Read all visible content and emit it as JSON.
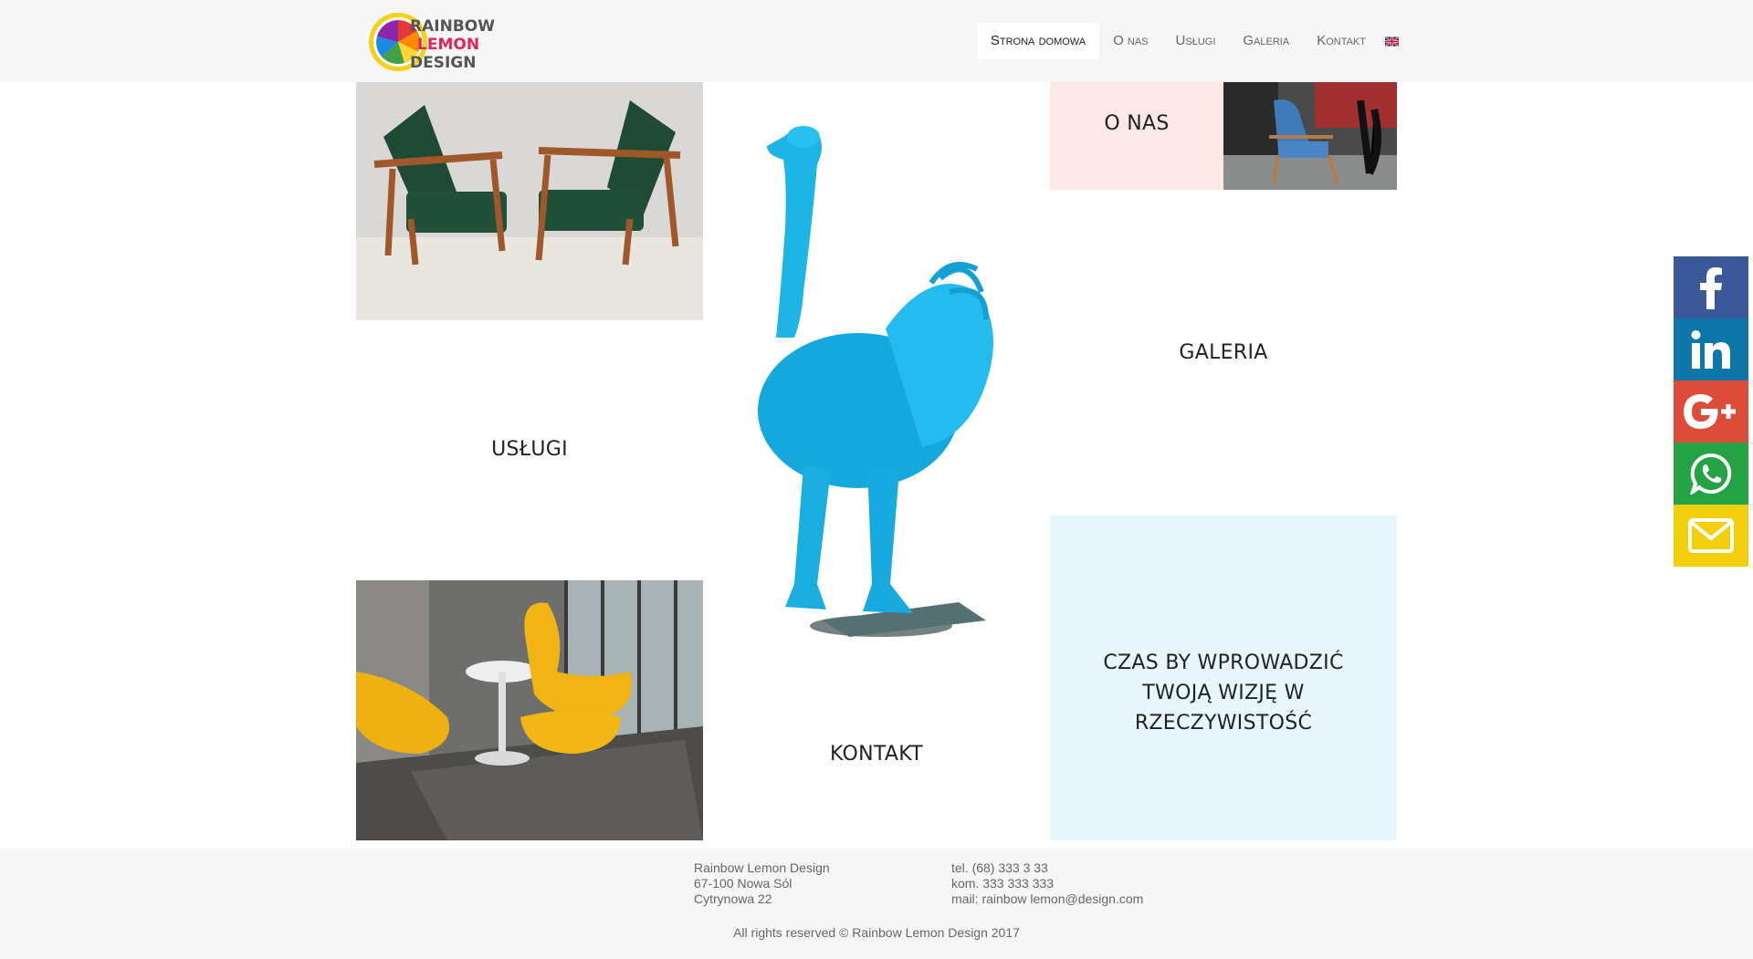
{
  "brand": {
    "logo_lines": [
      "RAINBOW",
      "LEMON",
      "DESIGN"
    ]
  },
  "nav": {
    "items": [
      {
        "label": "Strona domowa",
        "active": true
      },
      {
        "label": "O nas"
      },
      {
        "label": "Usługi"
      },
      {
        "label": "Galeria"
      },
      {
        "label": "Kontakt"
      }
    ],
    "language_icon": "uk-flag-icon"
  },
  "tiles": {
    "o_nas": "O NAS",
    "uslugi": "USŁUGI",
    "galeria": "GALERIA",
    "kontakt": "KONTAKT",
    "slogan": "CZAS BY WPROWADZIĆ TWOJĄ WIZJĘ W RZECZYWISTOŚĆ"
  },
  "social": [
    {
      "icon": "facebook-icon",
      "color": "#3b5998"
    },
    {
      "icon": "linkedin-icon",
      "color": "#0e76a8"
    },
    {
      "icon": "google-plus-icon",
      "color": "#dd4b39"
    },
    {
      "icon": "whatsapp-icon",
      "color": "#25a244"
    },
    {
      "icon": "email-icon",
      "color": "#f4cf0e"
    }
  ],
  "footer": {
    "company": "Rainbow Lemon Design",
    "postal": "67-100 Nowa Sól",
    "street": "Cytrynowa 22",
    "tel": "tel. (68) 333 3 33",
    "kom": "kom. 333 333 333",
    "mail": "mail: rainbow lemon@design.com",
    "copyright": "All rights reserved © Rainbow Lemon Design 2017"
  }
}
